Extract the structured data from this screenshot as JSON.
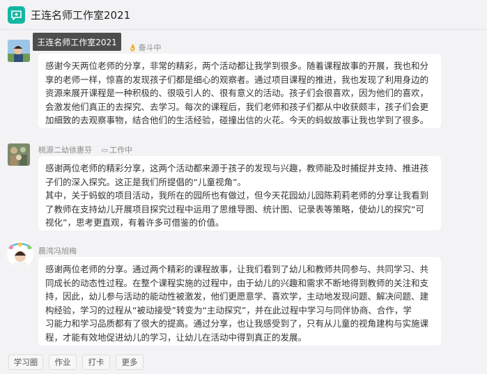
{
  "header": {
    "title": "王连名师工作室2021",
    "icon": "chat-bubble-icon",
    "accent": "#13b6a3"
  },
  "tooltip": {
    "text": "王连名师工作室2021"
  },
  "posts": [
    {
      "author": "",
      "status_icon": "hand-icon",
      "status": "奋斗中",
      "lines": [
        "感谢今天两位老师的分享，非常的精彩，两个活动都让我学到很多。随着课程故事的开展，我也和分",
        "享的老师一样，惊喜的发现孩子们都是细心的观察者。通过项目课程的推进，我也发现了利用身边的",
        "资源来展开课程是一种积极的、很吸引人的、很有意义的活动。孩子们会很喜欢，因为他们的喜欢，",
        "会激发他们真正的去探究、去学习。每次的课程后，我们老师和孩子们都从中收获颇丰，孩子们会更",
        "加细致的去观察事物，结合他们的生活经验，碰撞出信的火花。今天的蚂蚁故事让我也学到了很多。"
      ]
    },
    {
      "author": "桃源二幼徐惠芬",
      "status_icon": "comment-icon",
      "status": "工作中",
      "lines": [
        "感谢两位老师的精彩分享，这两个活动都来源于孩子的发现与兴趣，教师能及时捕捉并支持、推进孩",
        "子们的深入探究。这正是我们所提倡的“儿童视角”。",
        "其中，关于蚂蚁的项目活动，我所在的园所也有做过，但今天花园幼儿园陈莉莉老师的分享让我看到",
        "了教师在支持幼儿开展项目探究过程中运用了思维导图、统计图、记录表等策略，使幼儿的探究“可",
        "视化”，思考更直观，有着许多可借鉴的价值。"
      ]
    },
    {
      "author": "晨湾冯旭梅",
      "status_icon": "",
      "status": "",
      "lines": [
        "感谢两位老师的分享。通过两个精彩的课程故事，让我们看到了幼儿和教师共同参与、共同学习、共",
        "同成长的动态性过程。在整个课程实施的过程中，由于幼儿的兴趣和需求不断地得到教师的关注和支",
        "持，因此，幼儿参与活动的能动性被激发，他们更愿意学、喜欢学，主动地发现问题、解决问题、建",
        "构经验，学习的过程从“被动接受”转变为“主动探究”，并在此过程中学习与同伴协商、合作，学",
        "习能力和学习品质都有了很大的提高。通过分享，也让我感受到了，只有从儿童的视角建构与实施课",
        "程，才能有效地促进幼儿的学习，让幼儿在活动中得到真正的发展。"
      ]
    }
  ],
  "footer": {
    "buttons": [
      "学习圈",
      "作业",
      "打卡",
      "更多"
    ]
  }
}
